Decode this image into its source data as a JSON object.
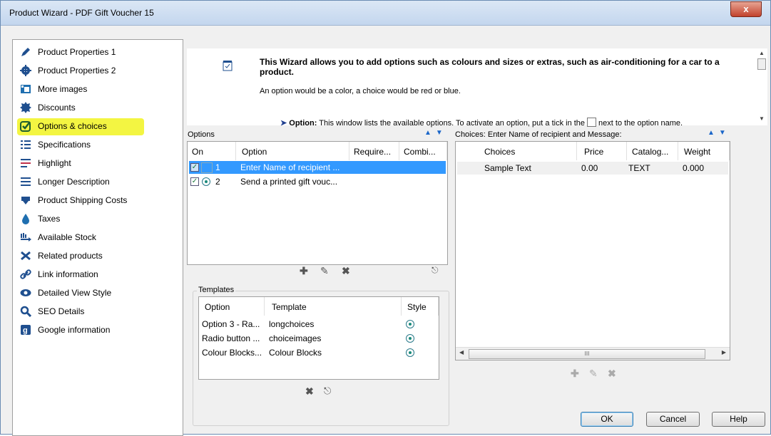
{
  "window": {
    "title": "Product Wizard - PDF Gift Voucher 15",
    "close_glyph": "x"
  },
  "nav": {
    "items": [
      {
        "label": "Product Properties 1",
        "icon": "pencil-icon"
      },
      {
        "label": "Product Properties 2",
        "icon": "gear-icon"
      },
      {
        "label": "More images",
        "icon": "images-icon"
      },
      {
        "label": "Discounts",
        "icon": "badge-icon"
      },
      {
        "label": "Options & choices",
        "icon": "check-icon"
      },
      {
        "label": "Specifications",
        "icon": "list-icon"
      },
      {
        "label": "Highlight",
        "icon": "highlight-icon"
      },
      {
        "label": "Longer Description",
        "icon": "lines-icon"
      },
      {
        "label": "Product Shipping Costs",
        "icon": "truck-icon"
      },
      {
        "label": "Taxes",
        "icon": "drop-icon"
      },
      {
        "label": "Available Stock",
        "icon": "stock-icon"
      },
      {
        "label": "Related products",
        "icon": "related-icon"
      },
      {
        "label": "Link information",
        "icon": "link-icon"
      },
      {
        "label": "Detailed View Style",
        "icon": "eye-icon"
      },
      {
        "label": "SEO Details",
        "icon": "search-icon"
      },
      {
        "label": "Google information",
        "icon": "google-icon"
      }
    ],
    "highlight_color": "#f3f542"
  },
  "intro": {
    "header": "This Wizard allows you to add options such as colours and sizes or extras, such as air-conditioning for a car to a product.",
    "sub": "An option would be a color, a choice would be red or blue.",
    "option_label": "Option:",
    "option_text_before": "This window lists the available options. To activate an option, put a tick in the",
    "option_text_after": "next to the option name."
  },
  "options": {
    "label": "Options",
    "columns": [
      "On",
      "Option",
      "Require...",
      "Combi..."
    ],
    "rows": [
      {
        "num": "1",
        "option": "Enter Name of recipient ...",
        "selected": true
      },
      {
        "num": "2",
        "option": "Send a printed gift vouc...",
        "selected": false
      }
    ]
  },
  "choices": {
    "label": "Choices: Enter Name of recipient and Message:",
    "columns": [
      "Choices",
      "Price",
      "Catalog...",
      "Weight"
    ],
    "rows": [
      {
        "choice": "Sample Text",
        "price": "0.00",
        "catalog": "TEXT",
        "weight": "0.000"
      }
    ],
    "scroll_glyph": "III"
  },
  "templates": {
    "label": "Templates",
    "columns": [
      "Option",
      "Template",
      "Style"
    ],
    "rows": [
      {
        "option": "Option 3 - Ra...",
        "template": "longchoices"
      },
      {
        "option": "Radio button ...",
        "template": "choiceimages"
      },
      {
        "option": "Colour Blocks...",
        "template": "Colour Blocks"
      }
    ]
  },
  "buttons": {
    "ok": "OK",
    "cancel": "Cancel",
    "help": "Help"
  },
  "colors": {
    "selection": "#3399ff",
    "accent_arrows": "#1a66c9"
  }
}
